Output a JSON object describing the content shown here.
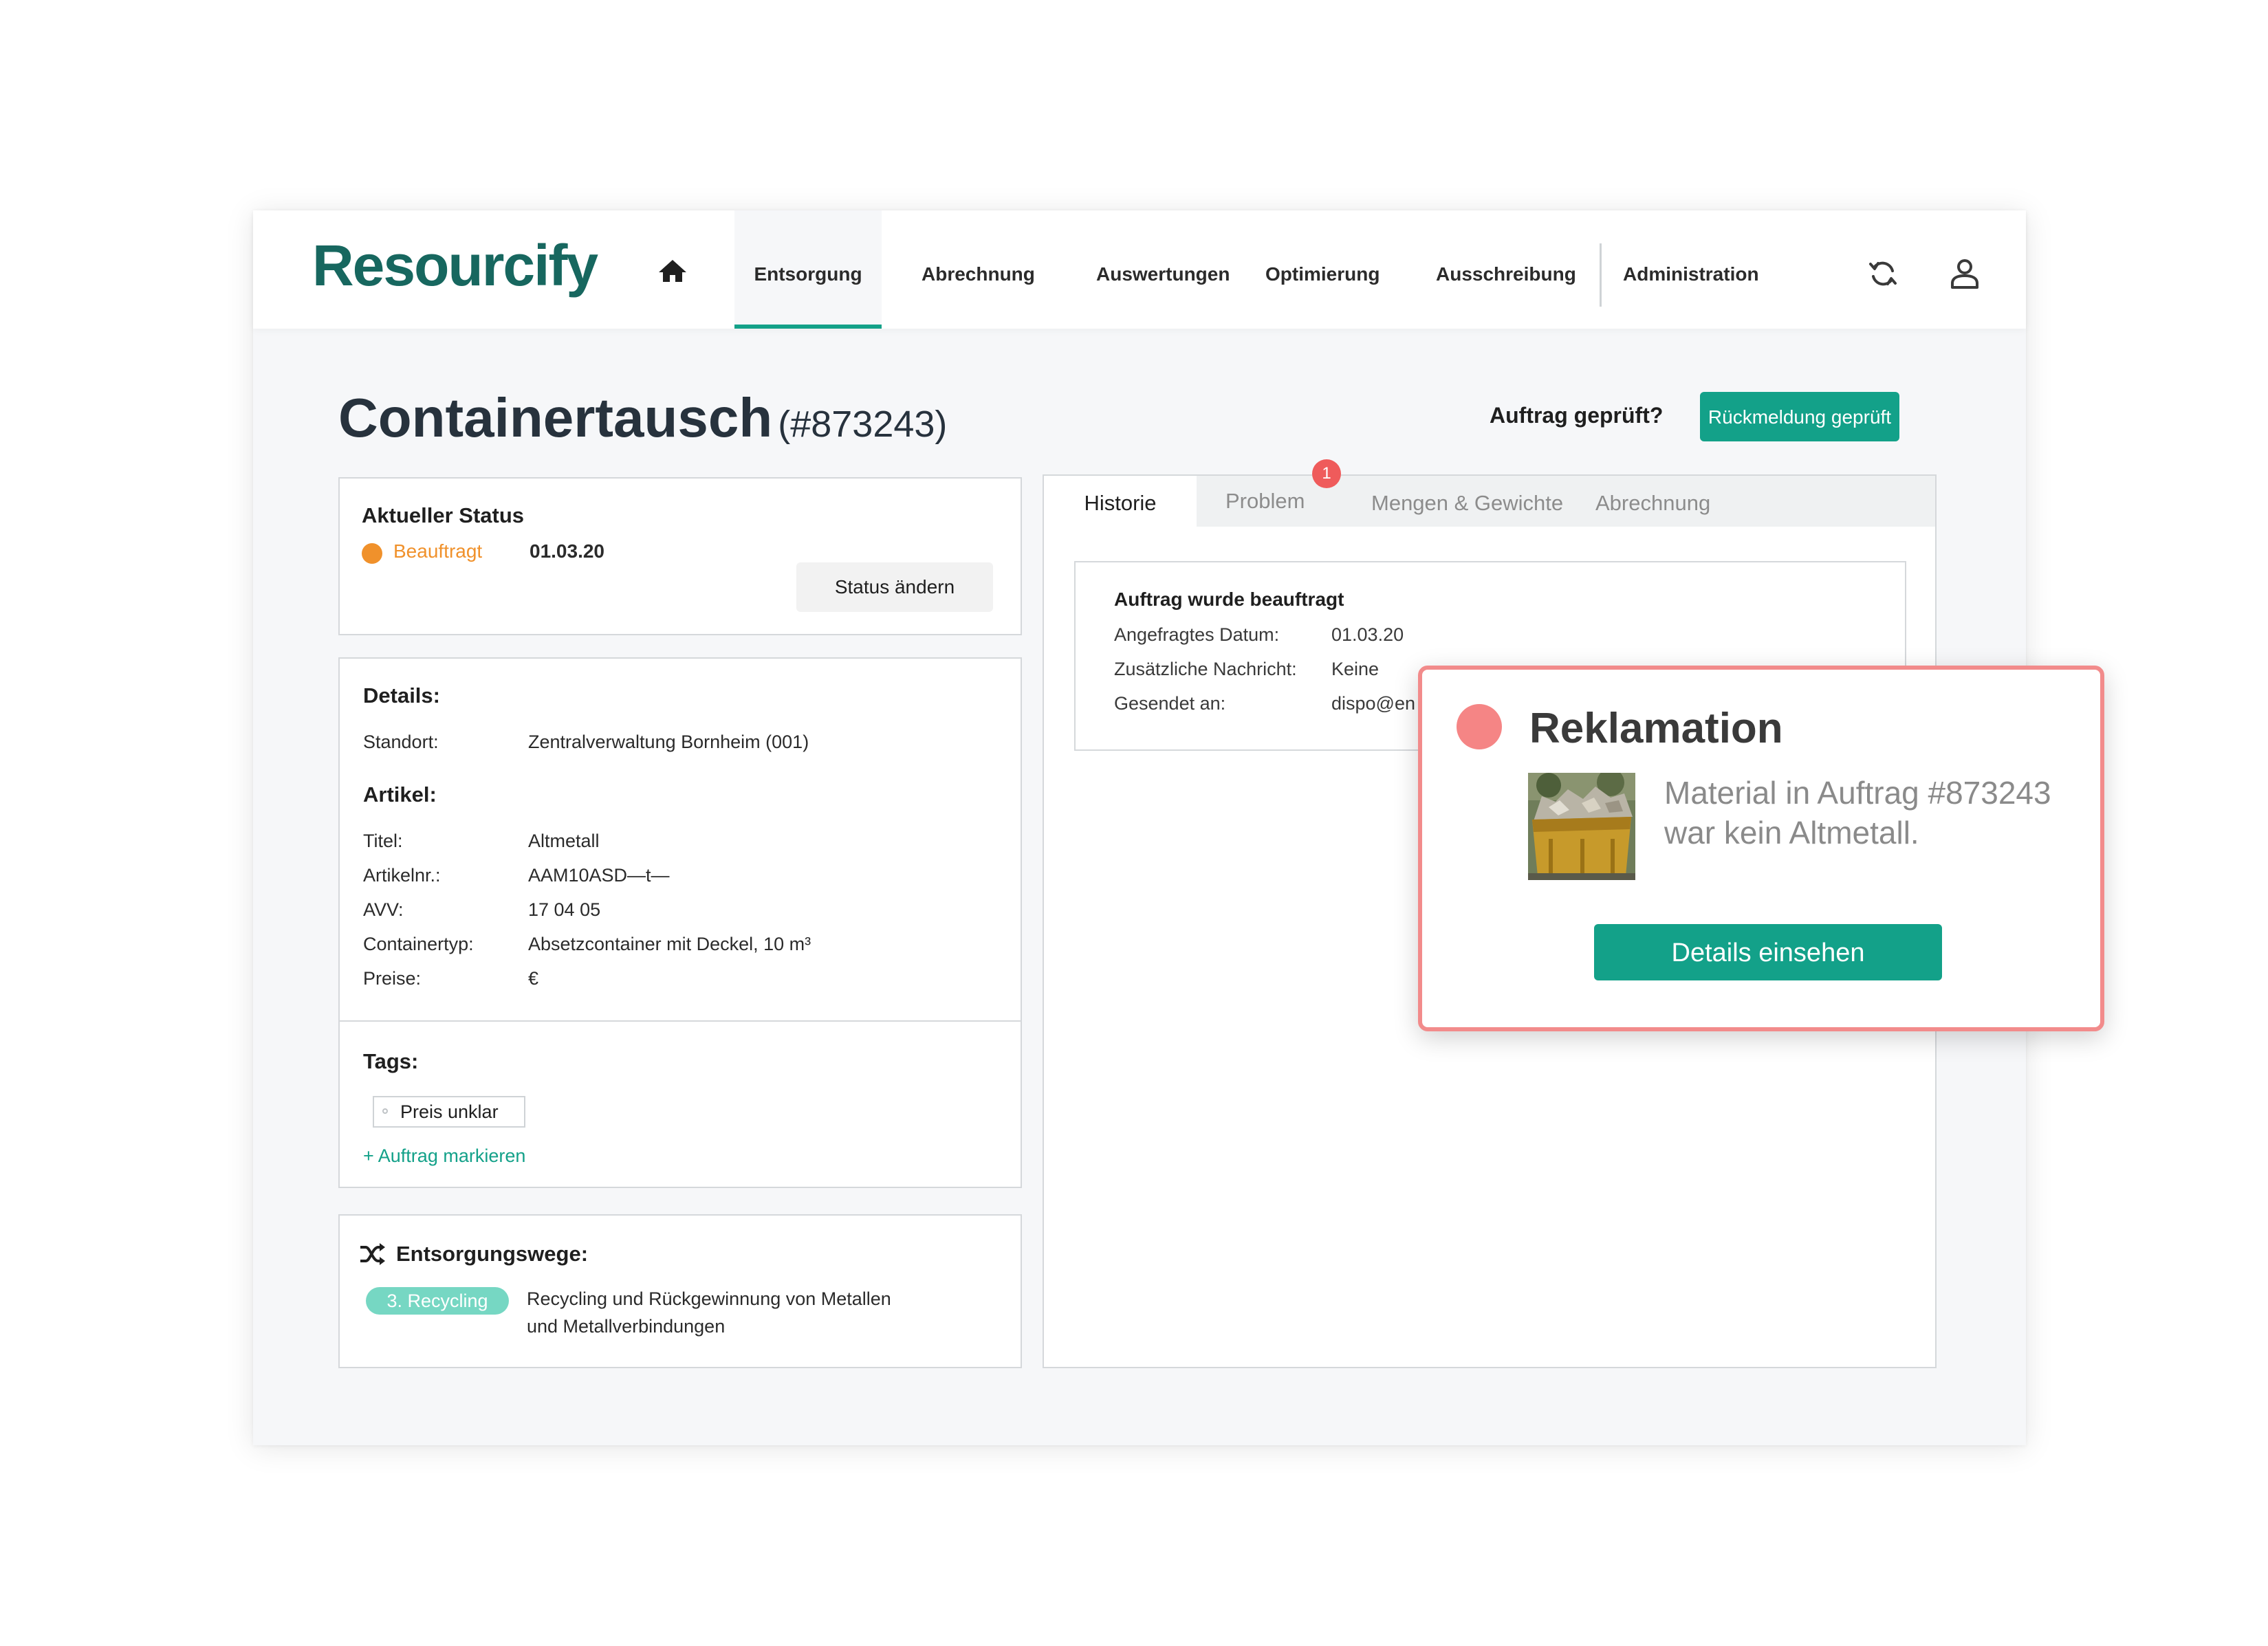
{
  "header": {
    "logo": "Resourcify",
    "nav": [
      "Entsorgung",
      "Abrechnung",
      "Auswertungen",
      "Optimierung",
      "Ausschreibung",
      "Administration"
    ],
    "active_nav": "Entsorgung",
    "icons": {
      "home": "home-icon",
      "sync": "sync-icon",
      "user": "user-icon"
    }
  },
  "page": {
    "title": "Containertausch",
    "order_number": "(#873243)",
    "checked_question": "Auftrag geprüft?",
    "feedback_button": "Rückmeldung geprüft"
  },
  "status": {
    "heading": "Aktueller Status",
    "value": "Beauftragt",
    "date": "01.03.20",
    "change_button": "Status ändern"
  },
  "details": {
    "heading": "Details:",
    "location_label": "Standort:",
    "location_value": "Zentralverwaltung Bornheim (001)",
    "article_heading": "Artikel:",
    "rows": [
      {
        "label": "Titel:",
        "value": "Altmetall"
      },
      {
        "label": "Artikelnr.:",
        "value": "AAM10ASD—t—"
      },
      {
        "label": "AVV:",
        "value": "17 04 05"
      },
      {
        "label": "Containertyp:",
        "value": "Absetzcontainer mit Deckel, 10 m³"
      },
      {
        "label": "Preise:",
        "value": "€"
      }
    ],
    "tags_heading": "Tags:",
    "tag": "Preis unklar",
    "mark_link": "+ Auftrag markieren"
  },
  "disposal": {
    "heading": "Entsorgungswege:",
    "pill": "3. Recycling",
    "line1": "Recycling und Rückgewinnung von Metallen",
    "line2": "und Metallverbindungen"
  },
  "tabs": {
    "items": [
      "Historie",
      "Problem",
      "Mengen & Gewichte",
      "Abrechnung"
    ],
    "active": "Historie",
    "problem_badge": "1"
  },
  "history": {
    "heading": "Auftrag wurde beauftragt",
    "rows": [
      {
        "label": "Angefragtes Datum:",
        "value": "01.03.20"
      },
      {
        "label": "Zusätzliche Nachricht:",
        "value": "Keine"
      },
      {
        "label": "Gesendet an:",
        "value": "dispo@en"
      }
    ]
  },
  "popup": {
    "title": "Reklamation",
    "message": "Material in Auftrag #873243 war kein Altmetall.",
    "button": "Details einsehen"
  },
  "colors": {
    "brand": "#17675f",
    "accent": "#13a189",
    "status_orange": "#f0912b",
    "alert_red": "#f58585",
    "pill_teal": "#76d7c3"
  }
}
